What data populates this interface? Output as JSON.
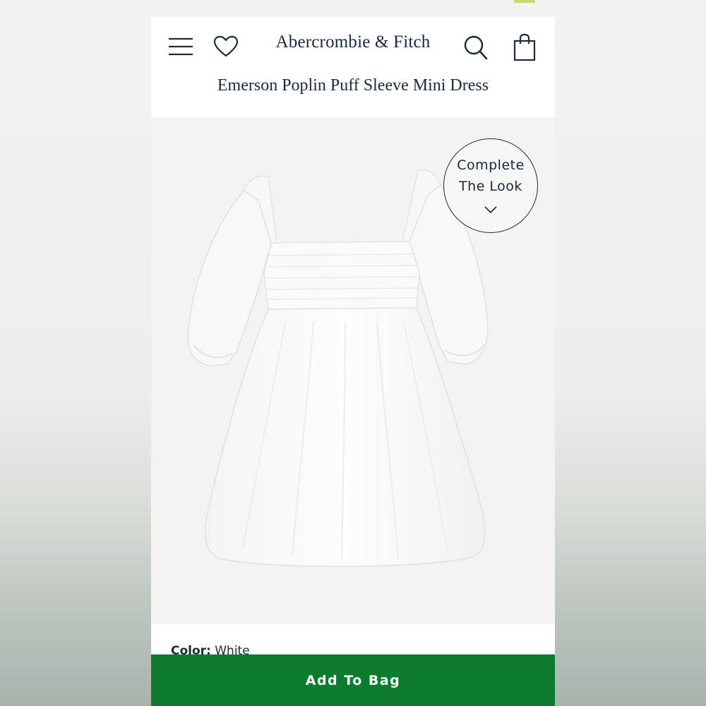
{
  "header": {
    "brand": "Abercrombie & Fitch",
    "icons": {
      "menu": "menu-icon",
      "wishlist": "heart-icon",
      "search": "search-icon",
      "bag": "shopping-bag-icon"
    }
  },
  "product": {
    "title": "Emerson Poplin Puff Sleeve Mini Dress",
    "color_label": "Color:",
    "color_value": "White"
  },
  "complete_look": {
    "line1": "Complete",
    "line2": "The Look",
    "icon": "chevron-down-icon"
  },
  "cta": {
    "add_to_bag": "Add To Bag"
  },
  "colors": {
    "brand_navy": "#1b2a3d",
    "cta_green": "#0b7b2e",
    "page_bg": "#ffffff"
  }
}
